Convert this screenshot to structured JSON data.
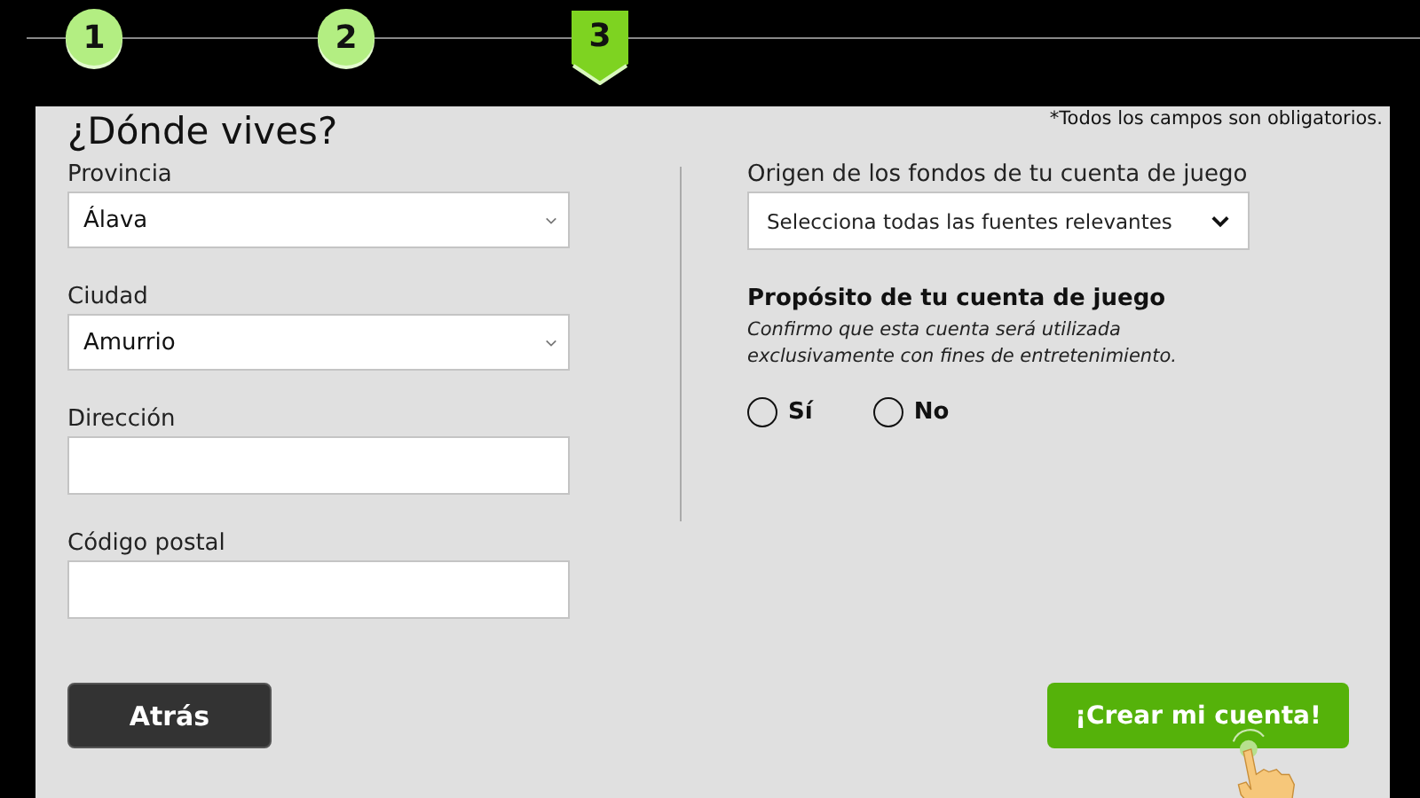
{
  "steps": [
    {
      "label": "1",
      "selected": false
    },
    {
      "label": "2",
      "selected": false
    },
    {
      "label": "3",
      "selected": true
    }
  ],
  "title": "¿Dónde vives?",
  "required_note": "*Todos los campos son obligatorios.",
  "left_fields": [
    {
      "kind": "select",
      "label": "Provincia",
      "value": "Álava"
    },
    {
      "kind": "select",
      "label": "Ciudad",
      "value": "Amurrio"
    },
    {
      "kind": "text",
      "label": "Dirección"
    },
    {
      "kind": "text",
      "label": "Código postal"
    }
  ],
  "funds": {
    "label": "Origen de los fondos de tu cuenta de juego",
    "placeholder": "Selecciona todas las fuentes relevantes"
  },
  "purpose": {
    "heading": "Propósito de tu cuenta de juego",
    "text": "Confirmo que esta cuenta será utilizada exclusivamente con fines de entretenimiento.",
    "options": [
      {
        "label": "Sí",
        "selected": false
      },
      {
        "label": "No",
        "selected": false
      }
    ]
  },
  "back_button": "Atrás",
  "create_button": "¡Crear mi cuenta!"
}
